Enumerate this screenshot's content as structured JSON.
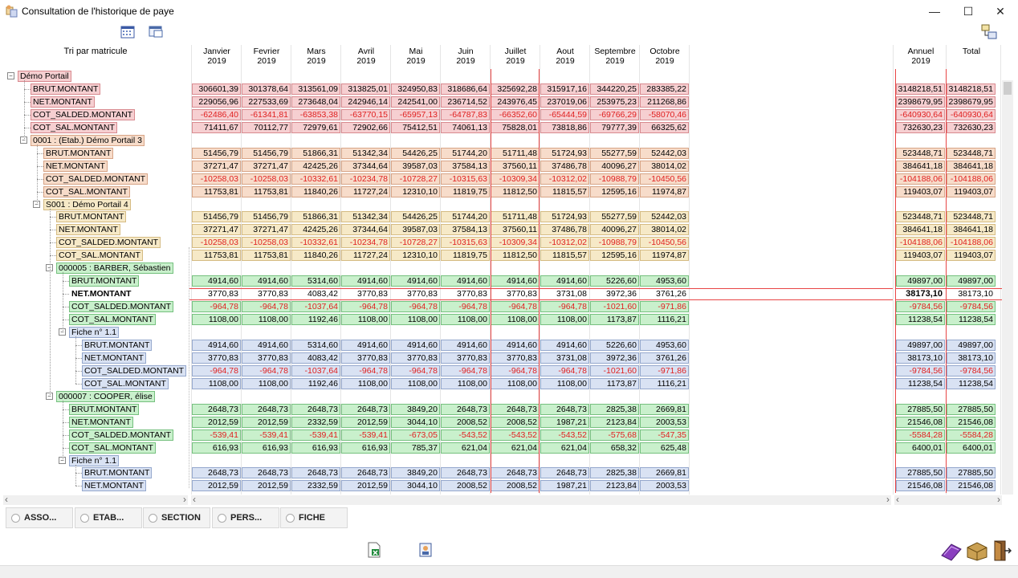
{
  "window": {
    "title": "Consultation de l'historique de paye",
    "minimize": "—",
    "maximize": "☐",
    "close": "✕"
  },
  "tree": {
    "header": "Tri par matricule",
    "nodes": [
      {
        "label": "Démo Portail",
        "level": 0,
        "color": "pink",
        "exp": true
      },
      {
        "label": "BRUT.MONTANT",
        "level": 1,
        "color": "pink"
      },
      {
        "label": "NET.MONTANT",
        "level": 1,
        "color": "pink"
      },
      {
        "label": "COT_SALDED.MONTANT",
        "level": 1,
        "color": "pink"
      },
      {
        "label": "COT_SAL.MONTANT",
        "level": 1,
        "color": "pink"
      },
      {
        "label": "0001 : (Etab.) Démo Portail 3",
        "level": 1,
        "color": "tan",
        "exp": true
      },
      {
        "label": "BRUT.MONTANT",
        "level": 2,
        "color": "tan"
      },
      {
        "label": "NET.MONTANT",
        "level": 2,
        "color": "tan"
      },
      {
        "label": "COT_SALDED.MONTANT",
        "level": 2,
        "color": "tan"
      },
      {
        "label": "COT_SAL.MONTANT",
        "level": 2,
        "color": "tan"
      },
      {
        "label": "S001 : Démo Portail 4",
        "level": 2,
        "color": "yel",
        "exp": true
      },
      {
        "label": "BRUT.MONTANT",
        "level": 3,
        "color": "yel"
      },
      {
        "label": "NET.MONTANT",
        "level": 3,
        "color": "yel"
      },
      {
        "label": "COT_SALDED.MONTANT",
        "level": 3,
        "color": "yel"
      },
      {
        "label": "COT_SAL.MONTANT",
        "level": 3,
        "color": "yel"
      },
      {
        "label": "000005 : BARBER, Sébastien",
        "level": 3,
        "color": "grn",
        "exp": true
      },
      {
        "label": "BRUT.MONTANT",
        "level": 4,
        "color": "grn"
      },
      {
        "label": "NET.MONTANT",
        "level": 4,
        "color": "sel"
      },
      {
        "label": "COT_SALDED.MONTANT",
        "level": 4,
        "color": "grn"
      },
      {
        "label": "COT_SAL.MONTANT",
        "level": 4,
        "color": "grn"
      },
      {
        "label": "Fiche n° 1.1",
        "level": 4,
        "color": "blu",
        "exp": true
      },
      {
        "label": "BRUT.MONTANT",
        "level": 5,
        "color": "blu"
      },
      {
        "label": "NET.MONTANT",
        "level": 5,
        "color": "blu"
      },
      {
        "label": "COT_SALDED.MONTANT",
        "level": 5,
        "color": "blu"
      },
      {
        "label": "COT_SAL.MONTANT",
        "level": 5,
        "color": "blu"
      },
      {
        "label": "000007 : COOPER, élise",
        "level": 3,
        "color": "grn",
        "exp": true
      },
      {
        "label": "BRUT.MONTANT",
        "level": 4,
        "color": "grn"
      },
      {
        "label": "NET.MONTANT",
        "level": 4,
        "color": "grn"
      },
      {
        "label": "COT_SALDED.MONTANT",
        "level": 4,
        "color": "grn"
      },
      {
        "label": "COT_SAL.MONTANT",
        "level": 4,
        "color": "grn"
      },
      {
        "label": "Fiche n° 1.1",
        "level": 4,
        "color": "blu",
        "exp": true
      },
      {
        "label": "BRUT.MONTANT",
        "level": 5,
        "color": "blu"
      },
      {
        "label": "NET.MONTANT",
        "level": 5,
        "color": "blu"
      }
    ]
  },
  "columns": [
    {
      "month": "Janvier",
      "year": "2019"
    },
    {
      "month": "Fevrier",
      "year": "2019"
    },
    {
      "month": "Mars",
      "year": "2019"
    },
    {
      "month": "Avril",
      "year": "2019"
    },
    {
      "month": "Mai",
      "year": "2019"
    },
    {
      "month": "Juin",
      "year": "2019"
    },
    {
      "month": "Juillet",
      "year": "2019"
    },
    {
      "month": "Aout",
      "year": "2019"
    },
    {
      "month": "Septembre",
      "year": "2019"
    },
    {
      "month": "Octobre",
      "year": "2019"
    }
  ],
  "totals_columns": [
    {
      "month": "Annuel",
      "year": "2019"
    },
    {
      "month": "Total",
      "year": ""
    }
  ],
  "rows": [
    null,
    [
      "306601,39",
      "301378,64",
      "313561,09",
      "313825,01",
      "324950,83",
      "318686,64",
      "325692,28",
      "315917,16",
      "344220,25",
      "283385,22",
      "3148218,51",
      "3148218,51"
    ],
    [
      "229056,96",
      "227533,69",
      "273648,04",
      "242946,14",
      "242541,00",
      "236714,52",
      "243976,45",
      "237019,06",
      "253975,23",
      "211268,86",
      "2398679,95",
      "2398679,95"
    ],
    [
      "-62486,40",
      "-61341,81",
      "-63853,38",
      "-63770,15",
      "-65957,13",
      "-64787,83",
      "-66352,60",
      "-65444,59",
      "-69766,29",
      "-58070,46",
      "-640930,64",
      "-640930,64"
    ],
    [
      "71411,67",
      "70112,77",
      "72979,61",
      "72902,66",
      "75412,51",
      "74061,13",
      "75828,01",
      "73818,86",
      "79777,39",
      "66325,62",
      "732630,23",
      "732630,23"
    ],
    null,
    [
      "51456,79",
      "51456,79",
      "51866,31",
      "51342,34",
      "54426,25",
      "51744,20",
      "51711,48",
      "51724,93",
      "55277,59",
      "52442,03",
      "523448,71",
      "523448,71"
    ],
    [
      "37271,47",
      "37271,47",
      "42425,26",
      "37344,64",
      "39587,03",
      "37584,13",
      "37560,11",
      "37486,78",
      "40096,27",
      "38014,02",
      "384641,18",
      "384641,18"
    ],
    [
      "-10258,03",
      "-10258,03",
      "-10332,61",
      "-10234,78",
      "-10728,27",
      "-10315,63",
      "-10309,34",
      "-10312,02",
      "-10988,79",
      "-10450,56",
      "-104188,06",
      "-104188,06"
    ],
    [
      "11753,81",
      "11753,81",
      "11840,26",
      "11727,24",
      "12310,10",
      "11819,75",
      "11812,50",
      "11815,57",
      "12595,16",
      "11974,87",
      "119403,07",
      "119403,07"
    ],
    null,
    [
      "51456,79",
      "51456,79",
      "51866,31",
      "51342,34",
      "54426,25",
      "51744,20",
      "51711,48",
      "51724,93",
      "55277,59",
      "52442,03",
      "523448,71",
      "523448,71"
    ],
    [
      "37271,47",
      "37271,47",
      "42425,26",
      "37344,64",
      "39587,03",
      "37584,13",
      "37560,11",
      "37486,78",
      "40096,27",
      "38014,02",
      "384641,18",
      "384641,18"
    ],
    [
      "-10258,03",
      "-10258,03",
      "-10332,61",
      "-10234,78",
      "-10728,27",
      "-10315,63",
      "-10309,34",
      "-10312,02",
      "-10988,79",
      "-10450,56",
      "-104188,06",
      "-104188,06"
    ],
    [
      "11753,81",
      "11753,81",
      "11840,26",
      "11727,24",
      "12310,10",
      "11819,75",
      "11812,50",
      "11815,57",
      "12595,16",
      "11974,87",
      "119403,07",
      "119403,07"
    ],
    null,
    [
      "4914,60",
      "4914,60",
      "5314,60",
      "4914,60",
      "4914,60",
      "4914,60",
      "4914,60",
      "4914,60",
      "5226,60",
      "4953,60",
      "49897,00",
      "49897,00"
    ],
    [
      "3770,83",
      "3770,83",
      "4083,42",
      "3770,83",
      "3770,83",
      "3770,83",
      "3770,83",
      "3731,08",
      "3972,36",
      "3761,26",
      "38173,10",
      "38173,10"
    ],
    [
      "-964,78",
      "-964,78",
      "-1037,64",
      "-964,78",
      "-964,78",
      "-964,78",
      "-964,78",
      "-964,78",
      "-1021,60",
      "-971,86",
      "-9784,56",
      "-9784,56"
    ],
    [
      "1108,00",
      "1108,00",
      "1192,46",
      "1108,00",
      "1108,00",
      "1108,00",
      "1108,00",
      "1108,00",
      "1173,87",
      "1116,21",
      "11238,54",
      "11238,54"
    ],
    null,
    [
      "4914,60",
      "4914,60",
      "5314,60",
      "4914,60",
      "4914,60",
      "4914,60",
      "4914,60",
      "4914,60",
      "5226,60",
      "4953,60",
      "49897,00",
      "49897,00"
    ],
    [
      "3770,83",
      "3770,83",
      "4083,42",
      "3770,83",
      "3770,83",
      "3770,83",
      "3770,83",
      "3731,08",
      "3972,36",
      "3761,26",
      "38173,10",
      "38173,10"
    ],
    [
      "-964,78",
      "-964,78",
      "-1037,64",
      "-964,78",
      "-964,78",
      "-964,78",
      "-964,78",
      "-964,78",
      "-1021,60",
      "-971,86",
      "-9784,56",
      "-9784,56"
    ],
    [
      "1108,00",
      "1108,00",
      "1192,46",
      "1108,00",
      "1108,00",
      "1108,00",
      "1108,00",
      "1108,00",
      "1173,87",
      "1116,21",
      "11238,54",
      "11238,54"
    ],
    null,
    [
      "2648,73",
      "2648,73",
      "2648,73",
      "2648,73",
      "3849,20",
      "2648,73",
      "2648,73",
      "2648,73",
      "2825,38",
      "2669,81",
      "27885,50",
      "27885,50"
    ],
    [
      "2012,59",
      "2012,59",
      "2332,59",
      "2012,59",
      "3044,10",
      "2008,52",
      "2008,52",
      "1987,21",
      "2123,84",
      "2003,53",
      "21546,08",
      "21546,08"
    ],
    [
      "-539,41",
      "-539,41",
      "-539,41",
      "-539,41",
      "-673,05",
      "-543,52",
      "-543,52",
      "-543,52",
      "-575,68",
      "-547,35",
      "-5584,28",
      "-5584,28"
    ],
    [
      "616,93",
      "616,93",
      "616,93",
      "616,93",
      "785,37",
      "621,04",
      "621,04",
      "621,04",
      "658,32",
      "625,48",
      "6400,01",
      "6400,01"
    ],
    null,
    [
      "2648,73",
      "2648,73",
      "2648,73",
      "2648,73",
      "3849,20",
      "2648,73",
      "2648,73",
      "2648,73",
      "2825,38",
      "2669,81",
      "27885,50",
      "27885,50"
    ],
    [
      "2012,59",
      "2012,59",
      "2332,59",
      "2012,59",
      "3044,10",
      "2008,52",
      "2008,52",
      "1987,21",
      "2123,84",
      "2003,53",
      "21546,08",
      "21546,08"
    ]
  ],
  "radios": [
    {
      "label": "ASSO..."
    },
    {
      "label": "ETAB..."
    },
    {
      "label": "SECTION"
    },
    {
      "label": "PERS..."
    },
    {
      "label": "FICHE"
    }
  ],
  "scroll": {
    "left": "‹",
    "right": "›",
    "up": "˄",
    "down": "˅"
  },
  "colors": {
    "pink": "#f6cfd1",
    "tan": "#f7dcca",
    "yellow": "#f6e9c7",
    "green": "#c9f0cc",
    "blue": "#d9e2f3",
    "negative": "#e02020",
    "selection_line": "#e84545"
  },
  "icons": [
    "calendar-icon",
    "window-icon",
    "tree-toggle-icon",
    "excel-icon",
    "report-icon",
    "book-icon",
    "box-icon",
    "exit-door-icon"
  ]
}
